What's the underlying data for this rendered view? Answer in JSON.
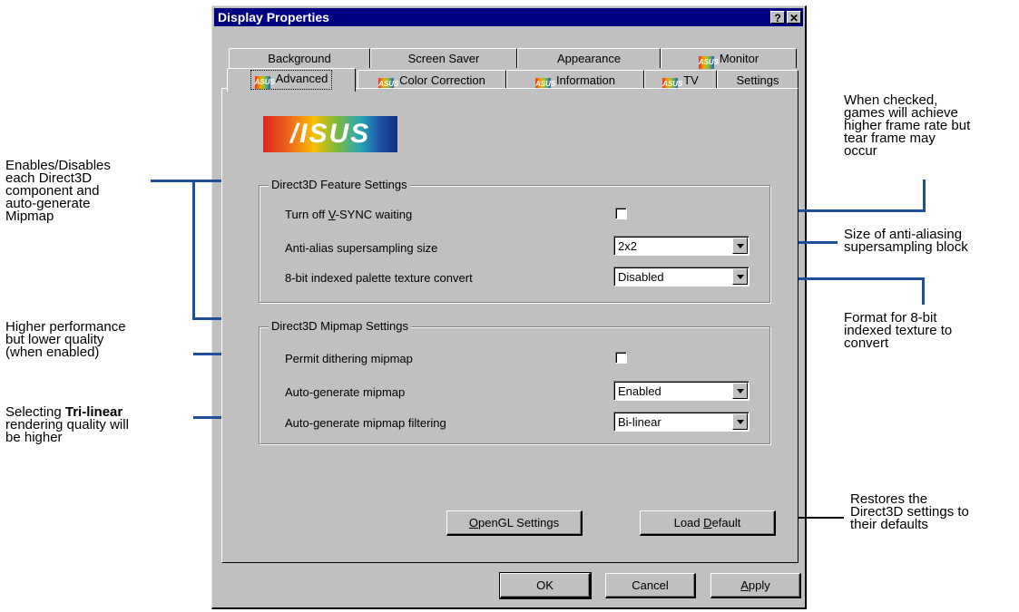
{
  "window": {
    "title": "Display Properties",
    "help_glyph": "?",
    "close_glyph": "✕"
  },
  "tabs_row1": [
    {
      "label": "Background",
      "asus": false
    },
    {
      "label": "Screen Saver",
      "asus": false
    },
    {
      "label": "Appearance",
      "asus": false
    },
    {
      "label": "Monitor",
      "asus": true
    }
  ],
  "tabs_row2": [
    {
      "label": "Advanced",
      "asus": true,
      "active": true
    },
    {
      "label": "Color Correction",
      "asus": true
    },
    {
      "label": "Information",
      "asus": true
    },
    {
      "label": "TV",
      "asus": true
    },
    {
      "label": "Settings",
      "asus": false
    }
  ],
  "asus_badge_text": "ASUS",
  "logo_text": "/ISUS",
  "feature_group": {
    "title": "Direct3D Feature Settings",
    "vsync": {
      "pre": "Turn off ",
      "key": "V",
      "post": "-SYNC waiting",
      "checked": false
    },
    "antialias": {
      "label": "Anti-alias supersampling size",
      "value": "2x2"
    },
    "palette": {
      "label": "8-bit indexed palette texture convert",
      "value": "Disabled"
    }
  },
  "mipmap_group": {
    "title": "Direct3D Mipmap Settings",
    "dither": {
      "label": "Permit dithering mipmap",
      "checked": false
    },
    "autogen": {
      "label": "Auto-generate mipmap",
      "value": "Enabled"
    },
    "filtering": {
      "label": "Auto-generate mipmap filtering",
      "value": "Bi-linear"
    }
  },
  "buttons": {
    "opengl": {
      "key": "O",
      "rest": "penGL Settings"
    },
    "load_default": {
      "pre": "Load ",
      "key": "D",
      "post": "efault"
    },
    "ok": "OK",
    "cancel": "Cancel",
    "apply": {
      "key": "A",
      "rest": "pply"
    }
  },
  "callouts": {
    "left_1": [
      "Enables/Disables",
      "each Direct3D",
      "component and",
      "auto-generate",
      "Mipmap"
    ],
    "left_2": [
      "Higher performance",
      "but lower quality",
      "(when enabled)"
    ],
    "left_3_pre": "Selecting ",
    "left_3_bold": "Tri-linear",
    "left_3_rest": [
      "rendering quality will",
      "be higher"
    ],
    "right_1": [
      "When checked,",
      "games will achieve",
      "higher frame rate but",
      "tear frame may",
      "occur"
    ],
    "right_2": [
      "Size of anti-aliasing",
      "supersampling block"
    ],
    "right_3": [
      "Format for 8-bit",
      "indexed texture to",
      "convert"
    ],
    "right_4": [
      "Restores the",
      "Direct3D settings to",
      "their defaults"
    ]
  },
  "colors": {
    "dialog": "#c0c0c0",
    "titlebar": "#000080",
    "callout_line": "#1f4e9c"
  }
}
